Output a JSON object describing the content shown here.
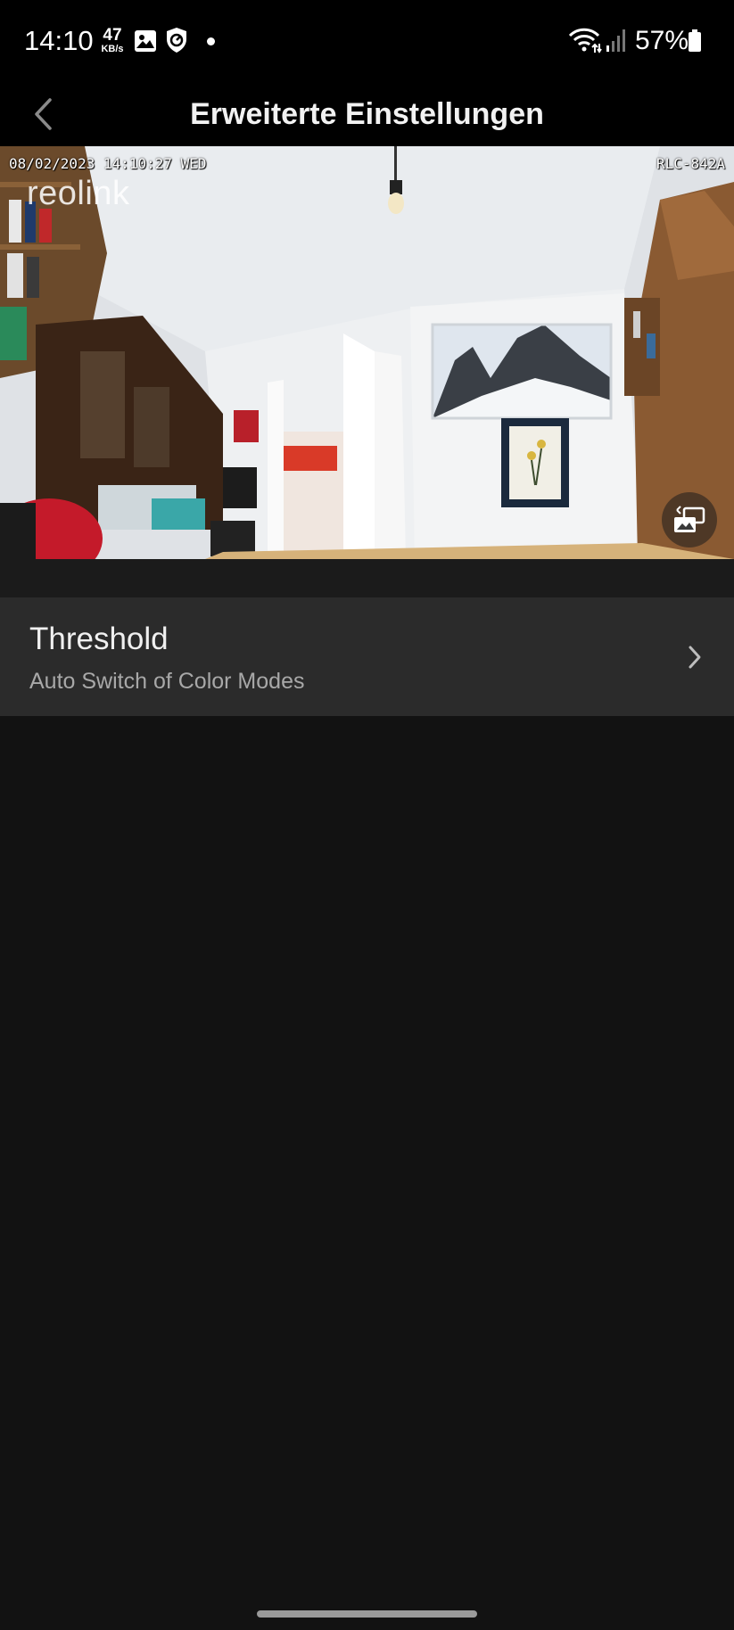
{
  "status_bar": {
    "time": "14:10",
    "net_speed_value": "47",
    "net_speed_unit": "KB/s",
    "battery_percent": "57%",
    "icons": [
      "gallery-icon",
      "shield-icon",
      "notification-dot",
      "wifi-icon",
      "signal-icon",
      "battery-icon"
    ]
  },
  "header": {
    "title": "Erweiterte Einstellungen",
    "back_icon": "chevron-left-icon"
  },
  "camera_preview": {
    "osd_datetime": "08/02/2023 14:10:27 WED",
    "osd_model": "RLC-842A",
    "watermark_logo": "reolink",
    "snapshot_icon": "snapshot-icon"
  },
  "settings_list": [
    {
      "title": "Threshold",
      "subtitle": "Auto Switch of Color Modes",
      "icon": "chevron-right-icon"
    }
  ],
  "colors": {
    "background": "#121212",
    "status_bar": "#000000",
    "list_item": "#2b2b2b",
    "subtitle_text": "#a8a8a8"
  }
}
